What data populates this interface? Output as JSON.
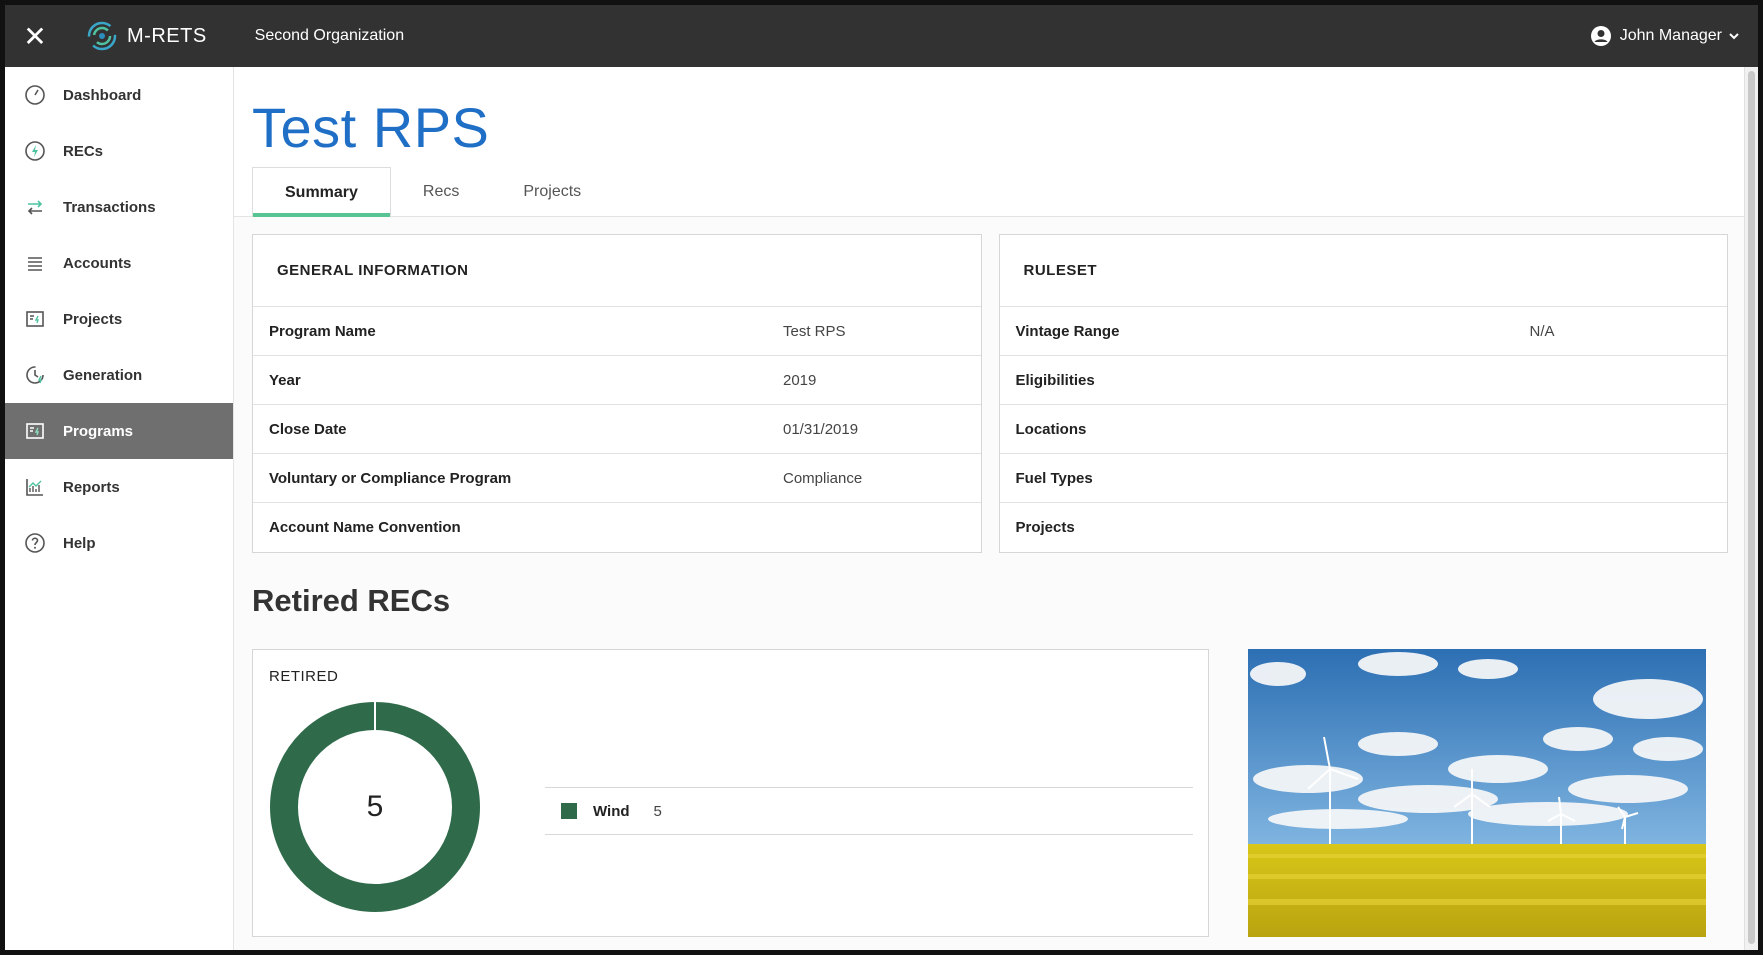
{
  "topbar": {
    "close_icon": "close-icon",
    "brand": "M-RETS",
    "organization": "Second Organization",
    "user": "John Manager"
  },
  "sidebar": {
    "items": [
      {
        "label": "Dashboard",
        "icon": "dashboard-icon"
      },
      {
        "label": "RECs",
        "icon": "recs-icon"
      },
      {
        "label": "Transactions",
        "icon": "transactions-icon"
      },
      {
        "label": "Accounts",
        "icon": "accounts-icon"
      },
      {
        "label": "Projects",
        "icon": "projects-icon"
      },
      {
        "label": "Generation",
        "icon": "generation-icon"
      },
      {
        "label": "Programs",
        "icon": "programs-icon",
        "active": true
      },
      {
        "label": "Reports",
        "icon": "reports-icon"
      },
      {
        "label": "Help",
        "icon": "help-icon"
      }
    ]
  },
  "page": {
    "title": "Test RPS",
    "tabs": [
      {
        "label": "Summary",
        "active": true
      },
      {
        "label": "Recs"
      },
      {
        "label": "Projects"
      }
    ]
  },
  "general_information": {
    "heading": "GENERAL INFORMATION",
    "rows": [
      {
        "label": "Program Name",
        "value": "Test RPS"
      },
      {
        "label": "Year",
        "value": "2019"
      },
      {
        "label": "Close Date",
        "value": "01/31/2019"
      },
      {
        "label": "Voluntary or Compliance Program",
        "value": "Compliance"
      },
      {
        "label": "Account Name Convention",
        "value": ""
      }
    ]
  },
  "ruleset": {
    "heading": "RULESET",
    "rows": [
      {
        "label": "Vintage Range",
        "value": "N/A"
      },
      {
        "label": "Eligibilities",
        "value": ""
      },
      {
        "label": "Locations",
        "value": ""
      },
      {
        "label": "Fuel Types",
        "value": ""
      },
      {
        "label": "Projects",
        "value": ""
      }
    ]
  },
  "retired": {
    "section_title": "Retired RECs",
    "card_label": "RETIRED",
    "total": "5",
    "legend": [
      {
        "name": "Wind",
        "value": "5",
        "color": "#2f6b4b"
      }
    ]
  },
  "colors": {
    "topbar": "#323232",
    "title_blue": "#1f6fc6",
    "tab_accent": "#58c393",
    "active_nav": "#6f6f6f",
    "wind_green": "#2f6b4b"
  }
}
